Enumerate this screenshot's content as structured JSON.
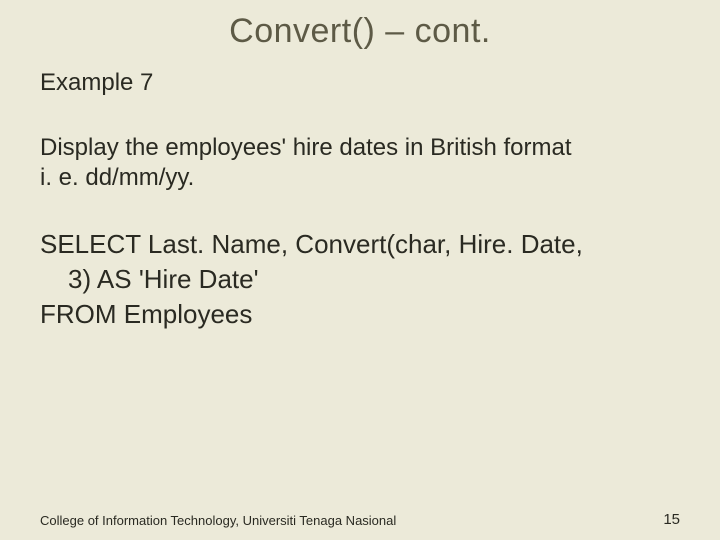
{
  "title": "Convert() – cont.",
  "subhead": "Example 7",
  "description_line1": "Display the employees' hire dates in British format",
  "description_line2": "i. e. dd/mm/yy.",
  "sql_line1": "SELECT Last. Name, Convert(char, Hire. Date,",
  "sql_line2": "3) AS 'Hire Date'",
  "sql_line3": "FROM Employees",
  "footer_left": "College of Information Technology, Universiti Tenaga Nasional",
  "footer_right": "15"
}
